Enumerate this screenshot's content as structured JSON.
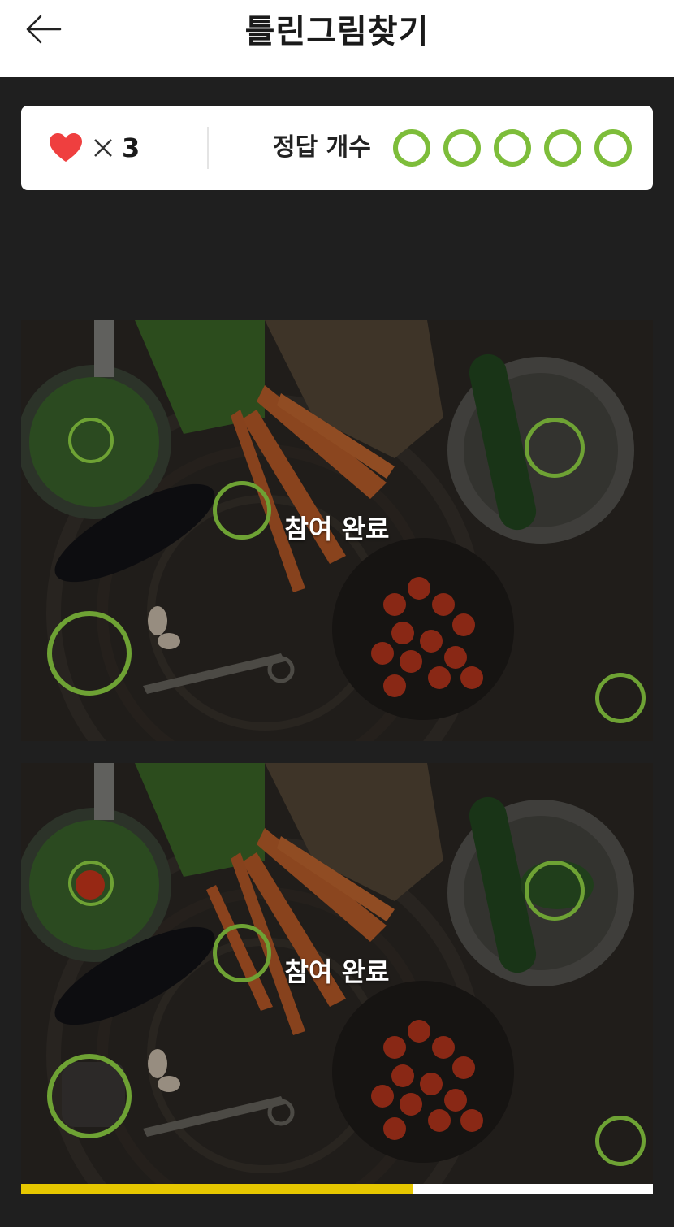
{
  "header": {
    "title": "틀린그림찾기",
    "back_icon": "arrow-left-icon"
  },
  "status": {
    "lives_icon": "heart-icon",
    "multiply_icon": "times-icon",
    "lives_count": "3",
    "answer_label": "정답 개수",
    "answer_slots": 5,
    "found_color": "#7dbd3a"
  },
  "panels": [
    {
      "id": "original",
      "overlay_text": "참여 완료",
      "found_markers": 5
    },
    {
      "id": "changed",
      "overlay_text": "참여 완료",
      "found_markers": 5
    }
  ],
  "progress": {
    "value": 0.62,
    "fill_color": "#e6c700"
  },
  "colors": {
    "background": "#1f1f1f",
    "accent_green": "#6ea234"
  }
}
